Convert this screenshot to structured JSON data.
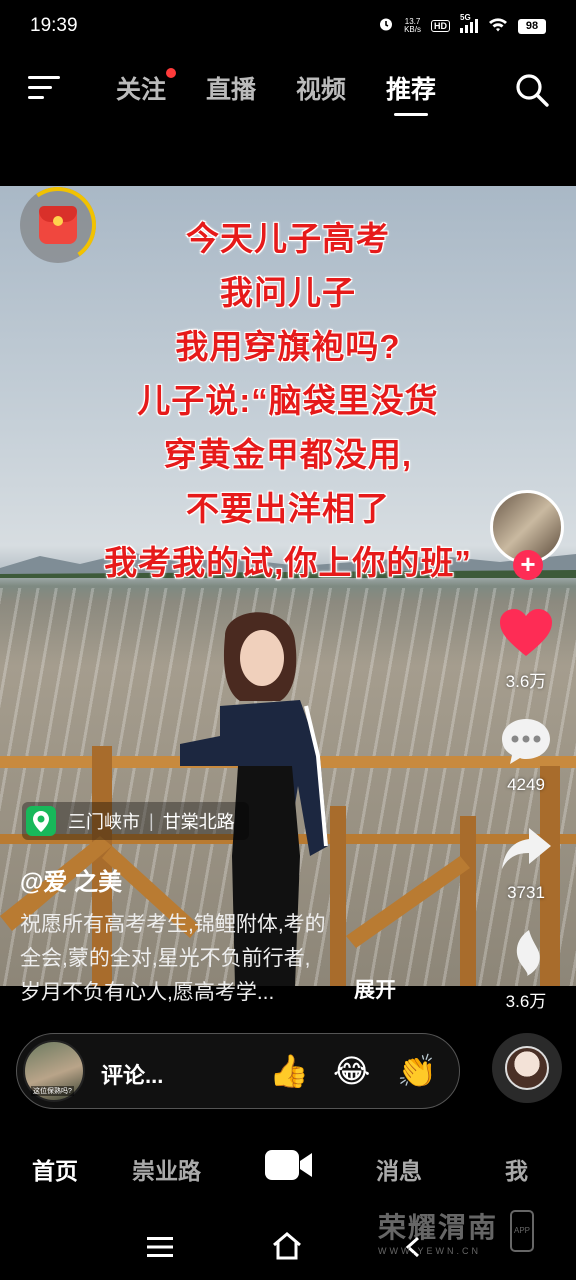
{
  "status_bar": {
    "time": "19:39",
    "net_speed_value": "13.7",
    "net_speed_unit": "KB/s",
    "hd_label": "HD",
    "network_label": "5G",
    "battery": "98"
  },
  "top_nav": {
    "tabs": [
      {
        "label": "关注",
        "has_dot": true
      },
      {
        "label": "直播"
      },
      {
        "label": "视频"
      },
      {
        "label": "推荐",
        "active": true
      }
    ]
  },
  "video": {
    "overlay_lines": [
      "今天儿子高考",
      "我问儿子",
      "我用穿旗袍吗?",
      "儿子说:“脑袋里没货",
      "穿黄金甲都没用,",
      "不要出洋相了",
      "我考我的试,你上你的班”"
    ]
  },
  "rail": {
    "like_count": "3.6万",
    "comment_count": "4249",
    "share_count": "3731",
    "favorite_count": "3.6万"
  },
  "caption": {
    "location_city": "三门峡市",
    "location_road": "甘棠北路",
    "author": "@爱 之美",
    "lines": [
      "祝愿所有高考考生,锦鲤附体,考的",
      "全会,蒙的全对,星光不负前行者,",
      "岁月不负有心人,愿高考学..."
    ],
    "expand_label": "展开"
  },
  "comment_bar": {
    "placeholder": "评论...",
    "thumb_caption": "这位保熟吗?",
    "emojis": [
      "👍",
      "😂",
      "👏"
    ]
  },
  "bottom_tabs": {
    "home": "首页",
    "city": "崇业路",
    "messages": "消息",
    "me": "我"
  },
  "watermark": {
    "main": "荣耀渭南",
    "sub": "WWW.YEWN.CN",
    "app": "APP"
  }
}
